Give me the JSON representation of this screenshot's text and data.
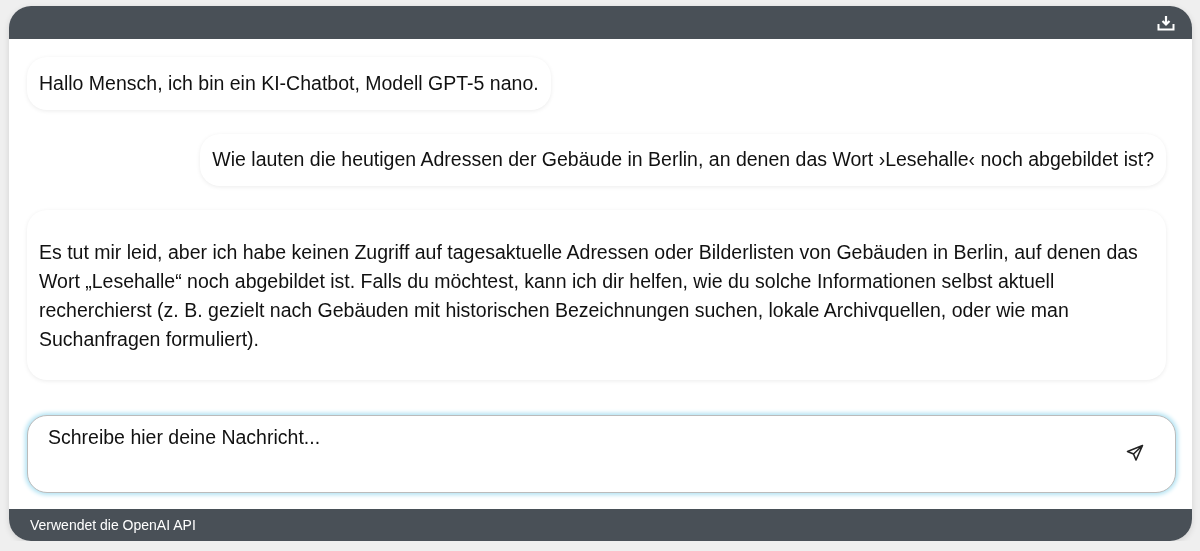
{
  "messages": [
    {
      "kind": "bot",
      "text": "Hallo Mensch, ich bin ein KI-Chatbot, Modell GPT-5 nano."
    },
    {
      "kind": "user",
      "text": "Wie lauten die heutigen Adressen der Gebäude in Berlin, an denen das Wort ›Lesehalle‹ noch abgebildet ist?"
    },
    {
      "kind": "bot",
      "text": "Es tut mir leid, aber ich habe keinen Zugriff auf tagesaktuelle Adressen oder Bilderlisten von Gebäuden in Berlin, auf denen das Wort „Lesehalle“ noch abgebildet ist. Falls du möchtest, kann ich dir helfen, wie du solche Informationen selbst aktuell recherchierst (z. B. gezielt nach Gebäuden mit historischen Bezeichnungen suchen, lokale Archivquellen, oder wie man Suchanfragen formuliert)."
    }
  ],
  "input": {
    "placeholder": "Schreibe hier deine Nachricht..."
  },
  "footer": {
    "text": "Verwendet die OpenAI API"
  }
}
